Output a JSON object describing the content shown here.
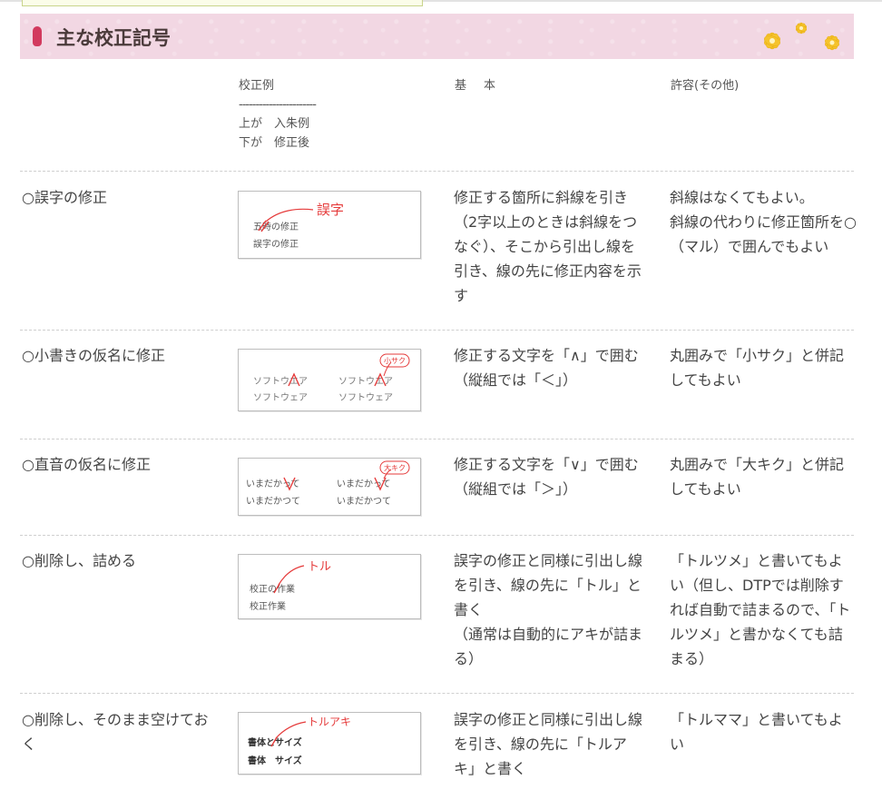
{
  "header": {
    "title": "主な校正記号"
  },
  "columns": {
    "example": {
      "label": "校正例",
      "separator": "-----------------------",
      "line1": "上が　入朱例",
      "line2": "下が　修正後"
    },
    "basic": "基　本",
    "allowance": "許容(その他)"
  },
  "rows": [
    {
      "label": "○誤字の修正",
      "basic": "修正する箇所に斜線を引き（2字以上のときは斜線をつなぐ）、そこから引出し線を引き、線の先に修正内容を示す",
      "allowance": "斜線はなくてもよい。\n斜線の代わりに修正箇所を○（マル）で囲んでもよい",
      "sample": {
        "before": "五時の修正",
        "after": "誤字の修正",
        "mark": "誤字"
      }
    },
    {
      "label": "○小書きの仮名に修正",
      "basic": "修正する文字を「∧」で囲む\n（縦組では「＜」）",
      "allowance": "丸囲みで「小サク」と併記してもよい",
      "sample": {
        "before_a": "ソフトウエア",
        "before_b": "ソフトウエア",
        "after_a": "ソフトウェア",
        "after_b": "ソフトウェア",
        "tag": "小サク"
      }
    },
    {
      "label": "○直音の仮名に修正",
      "basic": "修正する文字を「∨」で囲む（縦組では「＞」）",
      "allowance": "丸囲みで「大キク」と併記してもよい",
      "sample": {
        "before_a": "いまだかって",
        "before_b": "いまだかって",
        "after_a": "いまだかつて",
        "after_b": "いまだかつて",
        "tag": "大キク"
      }
    },
    {
      "label": "○削除し、詰める",
      "basic": "誤字の修正と同様に引出し線を引き、線の先に「トル」と書く\n（通常は自動的にアキが詰まる）",
      "allowance": "「トルツメ」と書いてもよい（但し、DTPでは削除すれば自動で詰まるので、「トルツメ」と書かなくても詰まる）",
      "sample": {
        "before": "校正の作業",
        "after": "校正作業",
        "mark": "トル"
      }
    },
    {
      "label": "○削除し、そのまま空けておく",
      "basic": "誤字の修正と同様に引出し線を引き、線の先に「トルアキ」と書く",
      "allowance": "「トルママ」と書いてもよい",
      "sample": {
        "before": "書体とサイズ",
        "after": "書体　サイズ",
        "mark": "トルアキ"
      }
    }
  ],
  "colors": {
    "header_bg": "#f2d7e3",
    "accent_red": "#e53b3b",
    "bullet": "#d23a5e",
    "flower": "#f5c32c"
  }
}
